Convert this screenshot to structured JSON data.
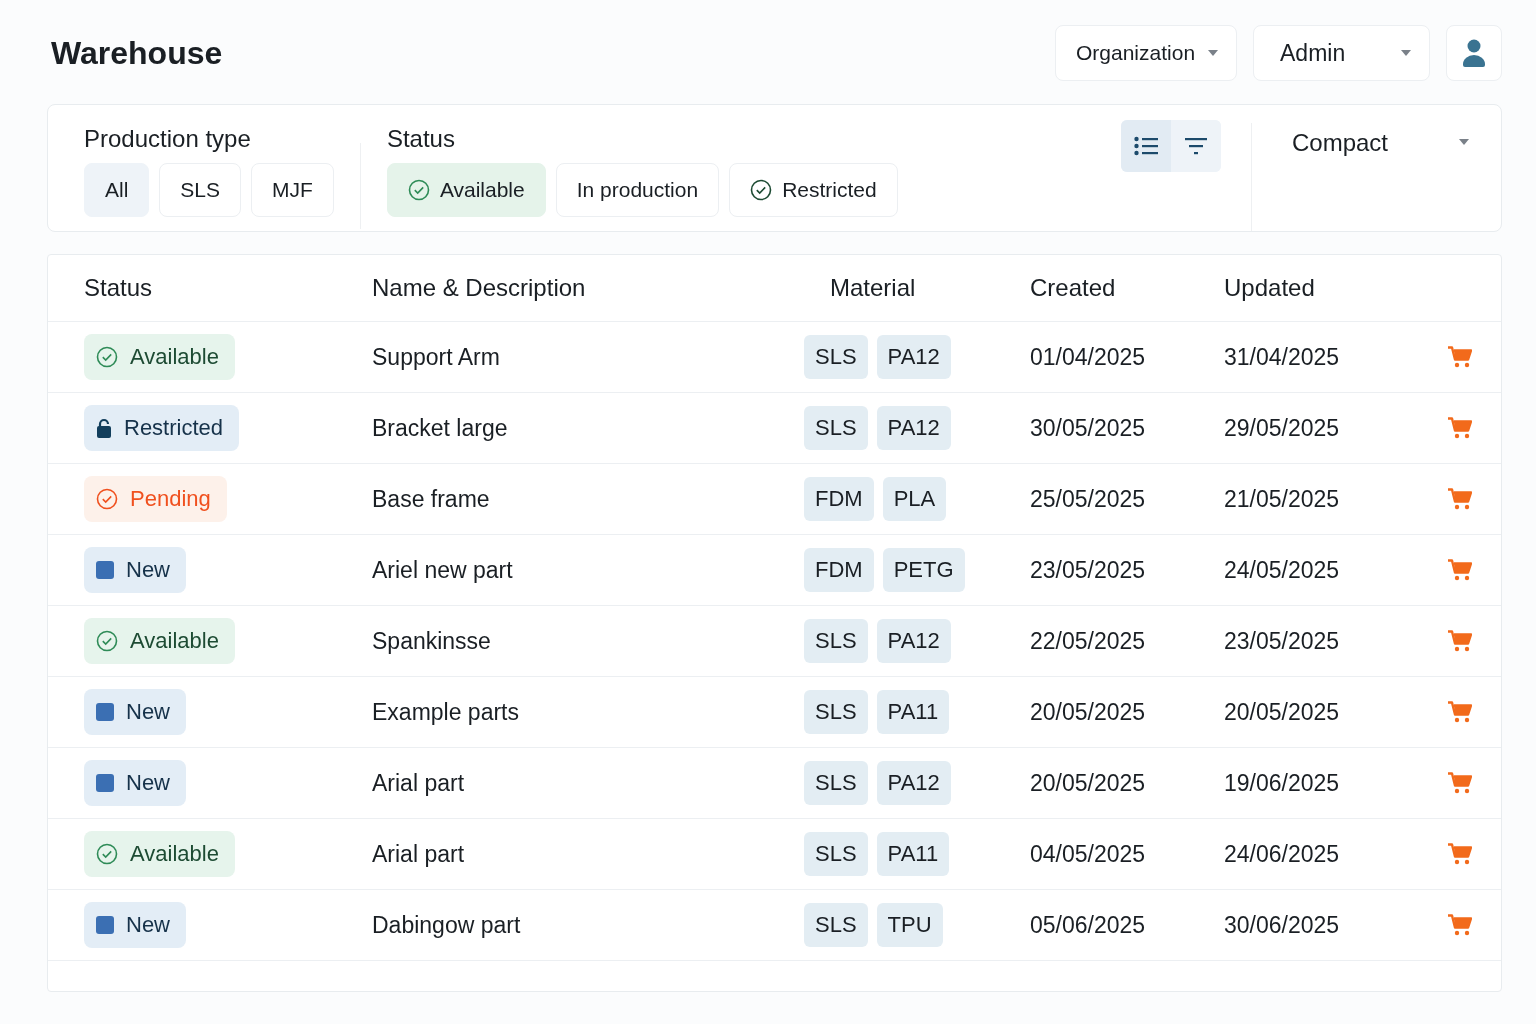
{
  "header": {
    "title": "Warehouse",
    "organization": "Organization",
    "role": "Admin"
  },
  "filters": {
    "production_type": {
      "label": "Production type",
      "options": [
        {
          "label": "All",
          "selected": true
        },
        {
          "label": "SLS",
          "selected": false
        },
        {
          "label": "MJF",
          "selected": false
        }
      ]
    },
    "status": {
      "label": "Status",
      "options": [
        {
          "label": "Available",
          "kind": "check",
          "selected": true
        },
        {
          "label": "In production",
          "kind": "plain",
          "selected": false
        },
        {
          "label": "Restricted",
          "kind": "check",
          "selected": false
        }
      ]
    },
    "view_buttons": [
      {
        "kind": "list",
        "selected": true
      },
      {
        "kind": "filter",
        "selected": false
      }
    ],
    "density": "Compact"
  },
  "table": {
    "columns": [
      "Status",
      "Name & Description",
      "Material",
      "Created",
      "Updated"
    ],
    "rows": [
      {
        "status": {
          "kind": "available",
          "label": "Available"
        },
        "name": "Support Arm",
        "process": "SLS",
        "material": "PA12",
        "created": "01/04/2025",
        "updated": "31/04/2025"
      },
      {
        "status": {
          "kind": "restricted",
          "label": "Restricted"
        },
        "name": "Bracket large",
        "process": "SLS",
        "material": "PA12",
        "created": "30/05/2025",
        "updated": "29/05/2025"
      },
      {
        "status": {
          "kind": "pending",
          "label": "Pending"
        },
        "name": "Base frame",
        "process": "FDM",
        "material": "PLA",
        "created": "25/05/2025",
        "updated": "21/05/2025"
      },
      {
        "status": {
          "kind": "new",
          "label": "New"
        },
        "name": "Ariel new part",
        "process": "FDM",
        "material": "PETG",
        "created": "23/05/2025",
        "updated": "24/05/2025"
      },
      {
        "status": {
          "kind": "available",
          "label": "Available"
        },
        "name": "Spankinsse",
        "process": "SLS",
        "material": "PA12",
        "created": "22/05/2025",
        "updated": "23/05/2025"
      },
      {
        "status": {
          "kind": "new",
          "label": "New"
        },
        "name": "Example parts",
        "process": "SLS",
        "material": "PA11",
        "created": "20/05/2025",
        "updated": "20/05/2025"
      },
      {
        "status": {
          "kind": "new",
          "label": "New"
        },
        "name": "Arial part",
        "process": "SLS",
        "material": "PA12",
        "created": "20/05/2025",
        "updated": "19/06/2025"
      },
      {
        "status": {
          "kind": "available",
          "label": "Available"
        },
        "name": "Arial part",
        "process": "SLS",
        "material": "PA11",
        "created": "04/05/2025",
        "updated": "24/06/2025"
      },
      {
        "status": {
          "kind": "new",
          "label": "New"
        },
        "name": "Dabingow part",
        "process": "SLS",
        "material": "TPU",
        "created": "05/06/2025",
        "updated": "30/06/2025"
      }
    ]
  }
}
